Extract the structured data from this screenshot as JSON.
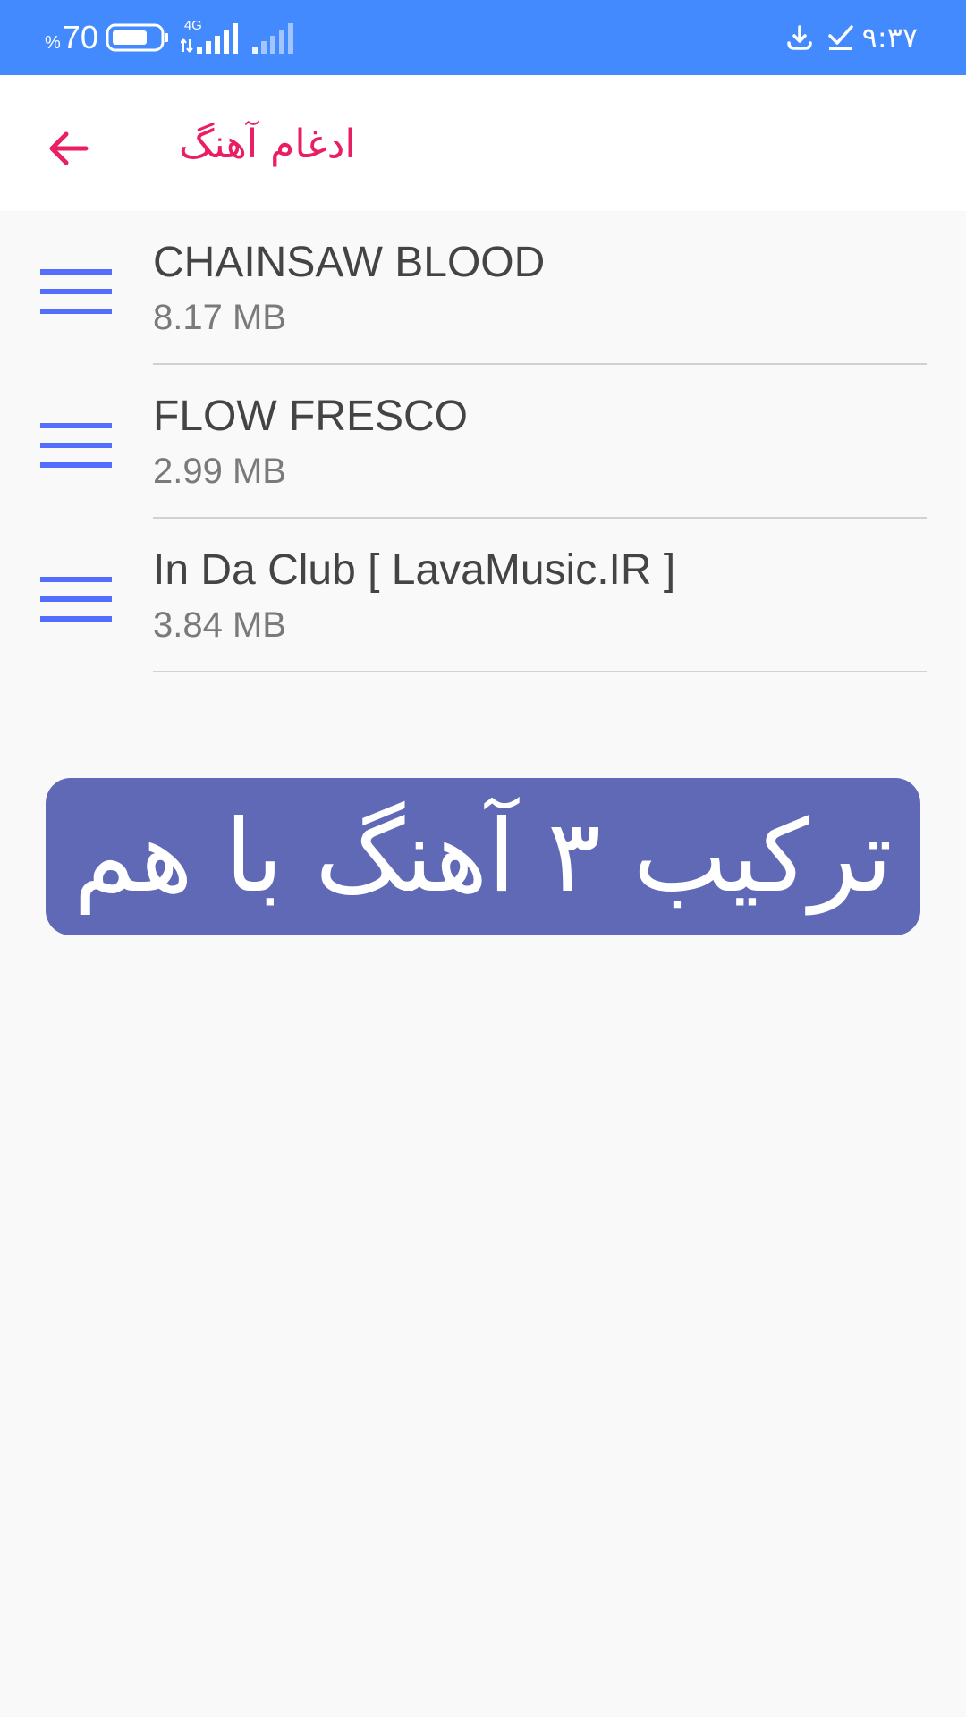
{
  "colors": {
    "status_bar": "#448aff",
    "accent": "#e91e63",
    "drag_handle": "#536dfe",
    "banner": "#5f69b6",
    "background": "#f9f9f9"
  },
  "status_bar": {
    "battery_percent_sign": "%",
    "battery_percent": "70",
    "battery_icon": "battery-icon",
    "network_type": "4G",
    "clock": "۹:۳۷"
  },
  "header": {
    "back_icon": "arrow-left-icon",
    "title": "ادغام آهنگ"
  },
  "songs": [
    {
      "name": "CHAINSAW BLOOD",
      "size": "8.17 MB"
    },
    {
      "name": "FLOW FRESCO",
      "size": "2.99 MB"
    },
    {
      "name": "In Da Club [ LavaMusic.IR ]",
      "size": "3.84 MB"
    }
  ],
  "banner": {
    "text": "ترکیب ۳ آهنگ با هم"
  }
}
